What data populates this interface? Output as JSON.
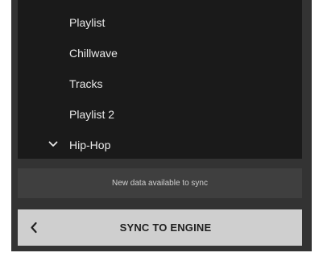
{
  "list": {
    "items": [
      {
        "label": "Playlist"
      },
      {
        "label": "Chillwave"
      },
      {
        "label": "Tracks"
      },
      {
        "label": "Playlist 2"
      },
      {
        "label": "Hip-Hop",
        "icon": "chevron-down-icon"
      }
    ]
  },
  "notice": {
    "text": "New data available to sync"
  },
  "sync": {
    "label": "SYNC TO ENGINE",
    "icon": "chevron-left-icon"
  },
  "colors": {
    "panel": "#333333",
    "list_bg": "#1a1a1a",
    "list_text": "#e9e9e9",
    "notice_bg": "#3f3f3f",
    "button_bg": "#cfcfcf"
  }
}
